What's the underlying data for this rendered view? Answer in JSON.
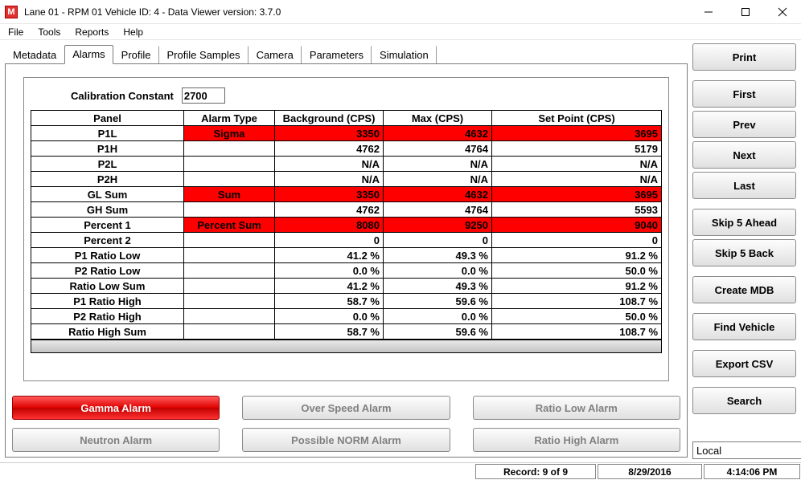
{
  "titlebar": {
    "app_icon_letter": "M",
    "title": "Lane 01 - RPM 01  Vehicle ID: 4 - Data Viewer     version: 3.7.0"
  },
  "menubar": [
    "File",
    "Tools",
    "Reports",
    "Help"
  ],
  "tabs": [
    "Metadata",
    "Alarms",
    "Profile",
    "Profile Samples",
    "Camera",
    "Parameters",
    "Simulation"
  ],
  "active_tab": 1,
  "calibration": {
    "label": "Calibration Constant",
    "value": "2700"
  },
  "grid": {
    "headers": [
      "Panel",
      "Alarm Type",
      "Background (CPS)",
      "Max (CPS)",
      "Set Point (CPS)"
    ],
    "rows": [
      {
        "panel": "P1L",
        "type": "Sigma",
        "bg": "3350",
        "max": "4632",
        "set": "3695",
        "alarm": true
      },
      {
        "panel": "P1H",
        "type": "",
        "bg": "4762",
        "max": "4764",
        "set": "5179",
        "alarm": false
      },
      {
        "panel": "P2L",
        "type": "",
        "bg": "N/A",
        "max": "N/A",
        "set": "N/A",
        "alarm": false
      },
      {
        "panel": "P2H",
        "type": "",
        "bg": "N/A",
        "max": "N/A",
        "set": "N/A",
        "alarm": false
      },
      {
        "panel": "GL Sum",
        "type": "Sum",
        "bg": "3350",
        "max": "4632",
        "set": "3695",
        "alarm": true
      },
      {
        "panel": "GH Sum",
        "type": "",
        "bg": "4762",
        "max": "4764",
        "set": "5593",
        "alarm": false
      },
      {
        "panel": "Percent 1",
        "type": "Percent Sum",
        "bg": "8080",
        "max": "9250",
        "set": "9040",
        "alarm": true
      },
      {
        "panel": "Percent 2",
        "type": "",
        "bg": "0",
        "max": "0",
        "set": "0",
        "alarm": false
      },
      {
        "panel": "P1 Ratio Low",
        "type": "",
        "bg": "41.2 %",
        "max": "49.3  %",
        "set": "91.2 %",
        "alarm": false
      },
      {
        "panel": "P2 Ratio Low",
        "type": "",
        "bg": "0.0 %",
        "max": "0.0  %",
        "set": "50.0 %",
        "alarm": false
      },
      {
        "panel": "Ratio Low Sum",
        "type": "",
        "bg": "41.2 %",
        "max": "49.3  %",
        "set": "91.2 %",
        "alarm": false
      },
      {
        "panel": "P1 Ratio High",
        "type": "",
        "bg": "58.7 %",
        "max": "59.6  %",
        "set": "108.7 %",
        "alarm": false
      },
      {
        "panel": "P2 Ratio High",
        "type": "",
        "bg": "0.0 %",
        "max": "0.0  %",
        "set": "50.0 %",
        "alarm": false
      },
      {
        "panel": "Ratio High Sum",
        "type": "",
        "bg": "58.7 %",
        "max": "59.6  %",
        "set": "108.7 %",
        "alarm": false
      }
    ]
  },
  "alarm_buttons": {
    "col1": [
      {
        "label": "Gamma Alarm",
        "active": true
      },
      {
        "label": "Neutron Alarm",
        "active": false
      }
    ],
    "col2": [
      {
        "label": "Over Speed Alarm",
        "active": false
      },
      {
        "label": "Possible NORM Alarm",
        "active": false
      }
    ],
    "col3": [
      {
        "label": "Ratio Low Alarm",
        "active": false
      },
      {
        "label": "Ratio High Alarm",
        "active": false
      }
    ]
  },
  "side_buttons": {
    "print": "Print",
    "first": "First",
    "prev": "Prev",
    "next": "Next",
    "last": "Last",
    "skip_ahead": "Skip 5 Ahead",
    "skip_back": "Skip 5 Back",
    "create_mdb": "Create MDB",
    "find_vehicle": "Find Vehicle",
    "export_csv": "Export CSV",
    "search": "Search"
  },
  "local_select": {
    "value": "Local"
  },
  "statusbar": {
    "record": "Record: 9 of 9",
    "date": "8/29/2016",
    "time": "4:14:06 PM"
  }
}
